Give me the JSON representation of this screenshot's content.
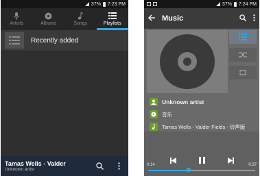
{
  "left": {
    "status": {
      "battery": "37%",
      "time": "7:23 PM"
    },
    "tabs": [
      {
        "label": "Artists",
        "icon": "mic-icon"
      },
      {
        "label": "Albums",
        "icon": "disc-icon"
      },
      {
        "label": "Songs",
        "icon": "note-icon"
      },
      {
        "label": "Playlists",
        "icon": "list-icon"
      }
    ],
    "active_tab": "Playlists",
    "list": [
      {
        "label": "Recently added",
        "icon": "playlist-icon"
      }
    ],
    "now_playing": {
      "title": "Tamas Wells - Valder",
      "artist": "Unknown artist"
    }
  },
  "right": {
    "status": {
      "battery": "37%",
      "time": "7:24 PM"
    },
    "title": "Music",
    "artist": "Unknown artist",
    "album": "音乐",
    "track": "Tamas Wells - Valder Fields - 铃声版",
    "elapsed": "0:14",
    "duration": "0:37",
    "progress": 0.38
  },
  "colors": {
    "accent": "#2ea7e8",
    "green": "#6aa02a"
  }
}
